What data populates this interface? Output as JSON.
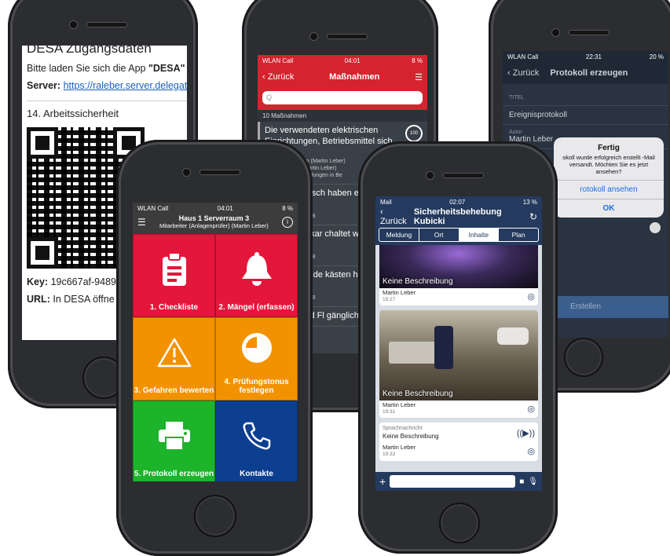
{
  "phone1": {
    "doc_heading": "DESA Zugangsdaten",
    "line1_prefix": "Bitte laden Sie sich die App ",
    "line1_app": "\"DESA\"",
    "server_label": "Server:",
    "server_url": "https://raleber.server.delegat",
    "section": "14. Arbeitssicherheit",
    "key_label": "Key:",
    "key_value": "19c667af-9489",
    "url_label": "URL:",
    "url_text": "In DESA öffne"
  },
  "phone2": {
    "status_left": "WLAN Call",
    "status_time": "04:01",
    "status_right": "8 %",
    "back_label": "Zurück",
    "title": "Maßnahmen",
    "search_placeholder": "Q",
    "section_label": "10 Maßnahmen",
    "badge": "100",
    "items": [
      {
        "text": "Die verwendeten elektrischen Einrichtungen, Betriebsmittel sich in...",
        "sub1": "Ausführung: Offen (Martin Leber)",
        "sub2": "Prüfung: Offen (Martin Leber)",
        "sub3": "Elektrische Gefährdungen in Be"
      },
      {
        "text": "deten elektrisch haben eine DG",
        "sub1": "en (Martin Leber)",
        "sub2": "(Martin Leber)",
        "sub3": "e Gefährdungen in B"
      },
      {
        "text": "versorgung kar chaltet werden",
        "sub1": "en (Martin Leber)",
        "sub2": "(Martin Leber)",
        "sub3": "e Gefährdungen in B"
      },
      {
        "text": "tzschalter in de kästen haben e",
        "sub1": "en (Martin Leber)",
        "sub2": "(Martin Leber)",
        "sub3": "e Gefährdungen in B"
      },
      {
        "text": "bereiche und Fl gänglich und ni",
        "sub1": "",
        "sub2": "",
        "sub3": ""
      }
    ]
  },
  "phone3": {
    "status_left": "WLAN Call",
    "status_time": "22:31",
    "status_right": "20 %",
    "back_label": "Zurück",
    "title": "Protokoll erzeugen",
    "section_label": "TITEL",
    "title_value": "Ereignisprotokoll",
    "author_label": "Autor",
    "author_value": "Martin Leber",
    "alert_title": "Fertig",
    "alert_message": "okoll wurde erfolgreich erstellt -Mail versandt. Möchten Sie es jetzt ansehen?",
    "alert_btn1": "rotokoll ansehen",
    "alert_btn2": "OK",
    "footer_button": "Erstellen"
  },
  "phone4": {
    "status_left": "WLAN Call",
    "status_time": "04:01",
    "status_right": "8 %",
    "title": "Haus 1 Serverraum 3",
    "subtitle": "Mitarbeiter (Anlagenprüfer) (Martin Leber)",
    "tiles": [
      {
        "label": "1. Checkliste",
        "color": "#e5163b",
        "icon": "clipboard-icon"
      },
      {
        "label": "2. Mängel (erfassen)",
        "color": "#e5163b",
        "icon": "bell-icon"
      },
      {
        "label": "3. Gefahren bewerten",
        "color": "#f39200",
        "icon": "warning-icon"
      },
      {
        "label": "4. Prüfungstonus festlegen",
        "color": "#f39200",
        "icon": "clock-icon"
      },
      {
        "label": "5. Protokoll erzeugen",
        "color": "#1db32b",
        "icon": "printer-icon"
      },
      {
        "label": "Kontakte",
        "color": "#0d3f91",
        "icon": "phone-icon"
      }
    ]
  },
  "phone5": {
    "status_left": "Mail",
    "status_time": "02:07",
    "status_right": "13 %",
    "back_label": "Zurück",
    "title": "Sicherheitsbehebung Kubicki",
    "segments": [
      "Meldung",
      "Ort",
      "Inhalte",
      "Plan"
    ],
    "active_segment": "Inhalte",
    "cards": [
      {
        "caption": "Keine Beschreibung",
        "author": "Martin Leber",
        "time": "19:27"
      },
      {
        "caption": "Keine Beschreibung",
        "author": "Martin Leber",
        "time": "19:31"
      }
    ],
    "voice": {
      "label": "Sprachnachricht",
      "text": "Keine Beschreibung",
      "author": "Martin Leber",
      "time": "19:32"
    }
  }
}
